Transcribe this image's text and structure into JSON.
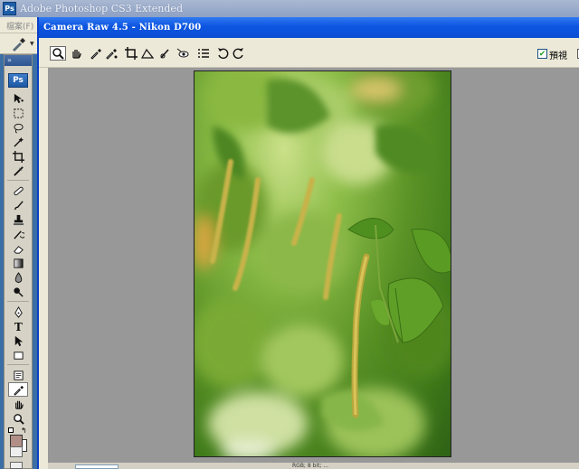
{
  "app": {
    "icon": "Ps",
    "title": "Adobe Photoshop CS3 Extended",
    "menu_file": "檔案(F)"
  },
  "toolbox": {
    "logo": "Ps",
    "grip": "»",
    "foreground_color": "#b28f86",
    "background_color": "#ffffff",
    "active_tool": "eyedropper-tool"
  },
  "camera_raw": {
    "title": "Camera Raw 4.5  -  Nikon D700",
    "active_tool": "zoom-tool",
    "preview_label": "預視",
    "preview_checked": true,
    "bottom_info": "RGB; 8 bit; ..."
  },
  "photo": {
    "subject": "green-leaves-photo",
    "accent": "#6aa22c"
  }
}
